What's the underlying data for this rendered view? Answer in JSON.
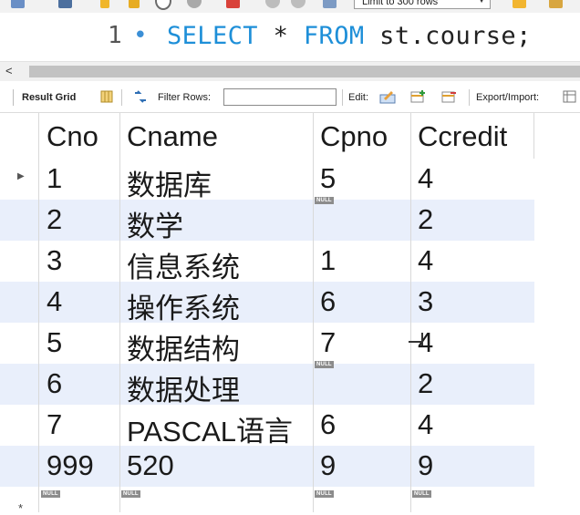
{
  "toolbar": {
    "limit_select": "Limit to 300 rows",
    "icons": [
      "folder-icon",
      "save-icon",
      "lightning-icon",
      "lightning-cursor-icon",
      "magnify-icon",
      "stop-icon",
      "no-stop-icon",
      "check-icon",
      "cancel-icon",
      "toggle-icon"
    ]
  },
  "editor": {
    "line_number": "1",
    "dot": "•",
    "tokens": [
      "SELECT",
      " * ",
      "FROM",
      " st.course;"
    ]
  },
  "result_toolbar": {
    "result_grid": "Result Grid",
    "filter_rows": "Filter Rows:",
    "filter_value": "",
    "edit": "Edit:",
    "export_import": "Export/Import:"
  },
  "grid": {
    "columns": [
      "Cno",
      "Cname",
      "Cpno",
      "Ccredit"
    ],
    "rows": [
      [
        "1",
        "数据库",
        "5",
        "4"
      ],
      [
        "2",
        "数学",
        "",
        "2"
      ],
      [
        "3",
        "信息系统",
        "1",
        "4"
      ],
      [
        "4",
        "操作系统",
        "6",
        "3"
      ],
      [
        "5",
        "数据结构",
        "7",
        "4"
      ],
      [
        "6",
        "数据处理",
        "",
        "2"
      ],
      [
        "7",
        "PASCAL语言",
        "6",
        "4"
      ],
      [
        "999",
        "520",
        "9",
        "9"
      ]
    ],
    "null_label": "NULL",
    "new_row_marker": "*"
  },
  "colors": {
    "keyword": "#1e8fd8",
    "alt_row": "#e9effb",
    "null_badge": "#8c8c8c"
  }
}
